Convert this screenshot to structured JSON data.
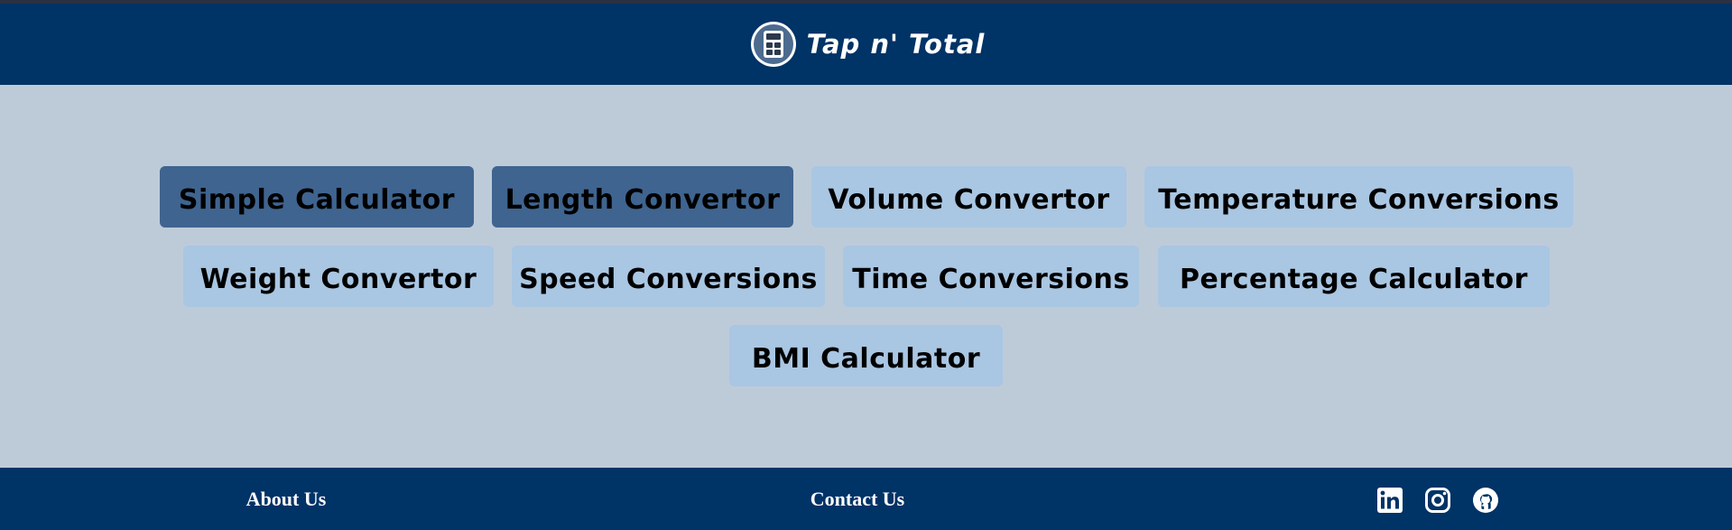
{
  "header": {
    "title": "Tap n' Total",
    "logo_icon": "calculator-icon"
  },
  "tools": [
    {
      "label": "Simple Calculator",
      "active": true
    },
    {
      "label": "Length Convertor",
      "active": true
    },
    {
      "label": "Volume Convertor",
      "active": false
    },
    {
      "label": "Temperature Conversions",
      "active": false
    },
    {
      "label": "Weight Convertor",
      "active": false
    },
    {
      "label": "Speed Conversions",
      "active": false
    },
    {
      "label": "Time Conversions",
      "active": false
    },
    {
      "label": "Percentage Calculator",
      "active": false
    },
    {
      "label": "BMI Calculator",
      "active": false
    }
  ],
  "footer": {
    "about_label": "About Us",
    "contact_label": "Contact Us",
    "social_icons": [
      "linkedin-icon",
      "instagram-icon",
      "github-icon"
    ]
  },
  "colors": {
    "header_bg": "#003366",
    "page_bg": "#bdcbd9",
    "button_bg": "#a9c6e2",
    "button_active_bg": "#3f648f",
    "footer_bg": "#003366"
  }
}
